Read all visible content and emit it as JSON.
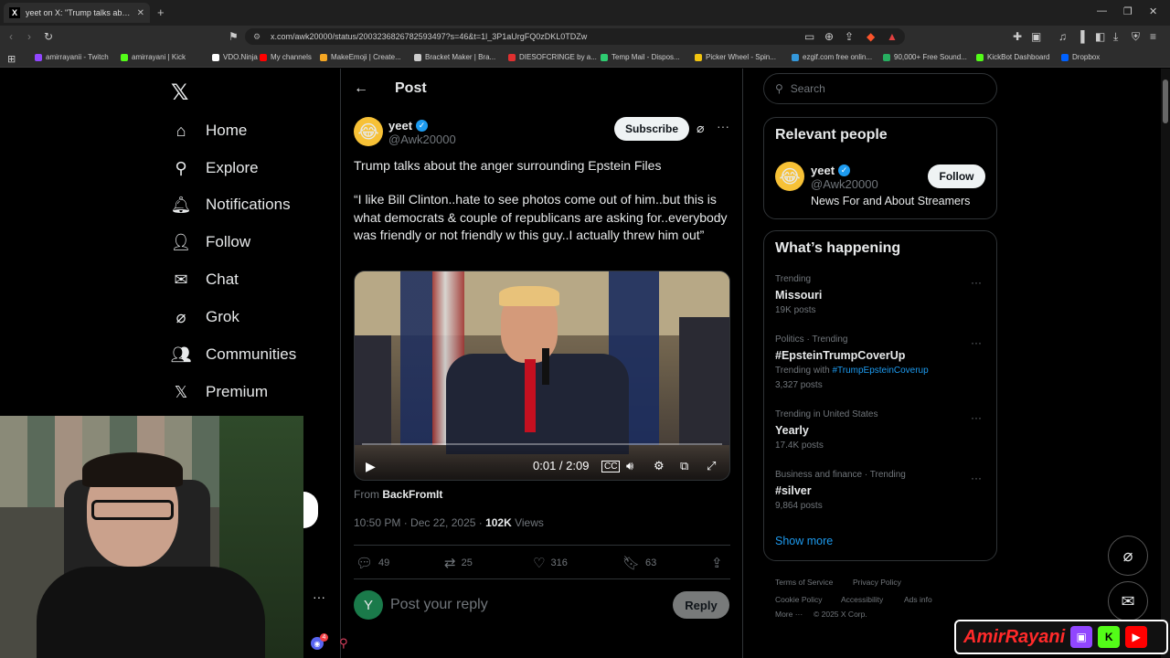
{
  "browser": {
    "tab_title": "yeet on X: \"Trump talks about th",
    "url": "x.com/awk20000/status/2003236826782593497?s=46&t=1l_3P1aUrgFQ0zDKL0TDZw",
    "bookmarks": [
      {
        "label": "amirrayanii - Twitch",
        "color": "#9146ff"
      },
      {
        "label": "amirrayani | Kick",
        "color": "#53fc18"
      },
      {
        "label": "VDO.Ninja",
        "color": "#ffffff"
      },
      {
        "label": "My channels",
        "color": "#ff0000"
      },
      {
        "label": "MakeEmoji | Create...",
        "color": "#f5a623"
      },
      {
        "label": "Bracket Maker | Bra...",
        "color": "#cccccc"
      },
      {
        "label": "DIESOFCRINGE by a...",
        "color": "#e03030"
      },
      {
        "label": "Temp Mail - Dispos...",
        "color": "#2ecc71"
      },
      {
        "label": "Picker Wheel - Spin...",
        "color": "#f1c40f"
      },
      {
        "label": "ezgif.com free onlin...",
        "color": "#3498db"
      },
      {
        "label": "90,000+ Free Sound...",
        "color": "#27ae60"
      },
      {
        "label": "KickBot Dashboard",
        "color": "#53fc18"
      },
      {
        "label": "Dropbox",
        "color": "#0061ff"
      }
    ]
  },
  "nav": {
    "items": [
      {
        "label": "Home",
        "icon": "⌂"
      },
      {
        "label": "Explore",
        "icon": "⚲"
      },
      {
        "label": "Notifications",
        "icon": "🔔︎"
      },
      {
        "label": "Follow",
        "icon": "👤︎"
      },
      {
        "label": "Chat",
        "icon": "✉"
      },
      {
        "label": "Grok",
        "icon": "⌀"
      },
      {
        "label": "Communities",
        "icon": "👥︎"
      },
      {
        "label": "Premium",
        "icon": "𝕏"
      }
    ]
  },
  "post": {
    "heading": "Post",
    "user_name": "yeet",
    "user_handle": "@Awk20000",
    "subscribe_label": "Subscribe",
    "text_line1": "Trump talks about the anger surrounding Epstein Files",
    "text_quote": "“I like Bill Clinton..hate to see photos come out of him..but this is what democrats & couple of republicans are asking for..everybody was friendly or not friendly w this guy..I actually threw him out”",
    "video_time": "0:01 / 2:09",
    "from_label": "From",
    "from_source": "BackFromIt",
    "timestamp": "10:50 PM · Dec 22, 2025 · ",
    "views_count": "102K",
    "views_label": " Views",
    "replies": "49",
    "reposts": "25",
    "likes": "316",
    "bookmarks": "63",
    "reply_avatar_letter": "Y",
    "reply_placeholder": "Post your reply",
    "reply_button": "Reply"
  },
  "sidebar": {
    "search_placeholder": "Search",
    "relevant_title": "Relevant people",
    "relevant_name": "yeet",
    "relevant_handle": "@Awk20000",
    "relevant_bio": "News For and About Streamers",
    "follow_label": "Follow",
    "happening_title": "What’s happening",
    "trends": [
      {
        "context": "Trending",
        "name": "Missouri",
        "sub": "19K posts",
        "with": ""
      },
      {
        "context": "Politics · Trending",
        "name": "#EpsteinTrumpCoverUp",
        "sub": "3,327 posts",
        "with": "#TrumpEpsteinCoverup"
      },
      {
        "context": "Trending in United States",
        "name": "Yearly",
        "sub": "17.4K posts",
        "with": ""
      },
      {
        "context": "Business and finance · Trending",
        "name": "#silver",
        "sub": "9,864 posts",
        "with": ""
      }
    ],
    "trending_with_label": "Trending with ",
    "show_more": "Show more",
    "footer": [
      "Terms of Service",
      "Privacy Policy",
      "Cookie Policy",
      "Accessibility",
      "Ads info",
      "More ···",
      "© 2025 X Corp."
    ]
  },
  "overlay": {
    "brand": "AmirRayani",
    "discord_badge": "4"
  }
}
